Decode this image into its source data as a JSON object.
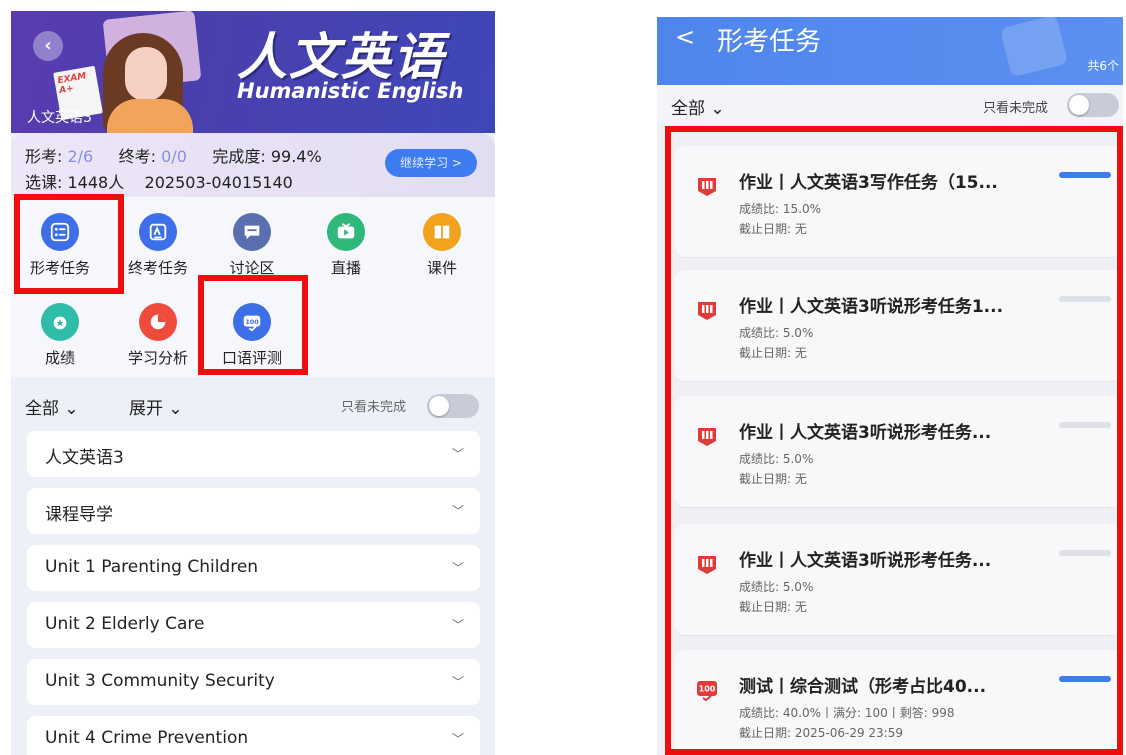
{
  "left": {
    "back_icon": "chevron-left-icon",
    "banner": {
      "title": "人文英语",
      "subtitle": "Humanistic English",
      "course_name": "人文英语3",
      "paper_text": "EXAM A+"
    },
    "stats": {
      "formative_label": "形考: ",
      "formative_value": "2/6",
      "final_label": "终考: ",
      "final_value": "0/0",
      "completion_label": "完成度: ",
      "completion_value": "99.4%",
      "enroll_text": "选课: 1448人",
      "course_code": "202503-04015140",
      "continue_label": "继续学习 >"
    },
    "tiles": [
      {
        "label": "形考任务",
        "icon": "task-list-icon",
        "color": "#3d6fe8"
      },
      {
        "label": "终考任务",
        "icon": "exam-icon",
        "color": "#3d6fe8"
      },
      {
        "label": "讨论区",
        "icon": "chat-bubble-icon",
        "color": "#5a6fb0"
      },
      {
        "label": "直播",
        "icon": "live-tv-icon",
        "color": "#2fb87a"
      },
      {
        "label": "课件",
        "icon": "book-icon",
        "color": "#f2a21c"
      },
      {
        "label": "成绩",
        "icon": "medal-icon",
        "color": "#2fbca8"
      },
      {
        "label": "学习分析",
        "icon": "pie-chart-icon",
        "color": "#f04a3a"
      },
      {
        "label": "口语评测",
        "icon": "speaking-score-icon",
        "color": "#3d6fe8"
      }
    ],
    "filter": {
      "all_label": "全部 ⌄",
      "expand_label": "展开 ⌄",
      "only_incomplete_label": "只看未完成"
    },
    "units": [
      "人文英语3",
      "课程导学",
      "Unit 1 Parenting Children",
      "Unit 2 Elderly Care",
      "Unit 3 Community Security",
      "Unit 4 Crime Prevention"
    ]
  },
  "right": {
    "back_icon": "chevron-left-icon",
    "header_back": "<",
    "title": "形考任务",
    "count_text": "共6个",
    "filter_all_label": "全部 ⌄",
    "only_incomplete_label": "只看未完成",
    "tasks": [
      {
        "title": "作业丨人文英语3写作任务（15...",
        "line1": "成绩比: 15.0%",
        "line2": "截止日期:  无",
        "icon": "homework-icon",
        "progress": 1.0
      },
      {
        "title": "作业丨人文英语3听说形考任务1...",
        "line1": "成绩比: 5.0%",
        "line2": "截止日期:  无",
        "icon": "homework-icon",
        "progress": 0.0
      },
      {
        "title": "作业丨人文英语3听说形考任务...",
        "line1": "成绩比: 5.0%",
        "line2": "截止日期:  无",
        "icon": "homework-icon",
        "progress": 0.0
      },
      {
        "title": "作业丨人文英语3听说形考任务...",
        "line1": "成绩比: 5.0%",
        "line2": "截止日期:  无",
        "icon": "homework-icon",
        "progress": 0.0
      },
      {
        "title": "测试丨综合测试（形考占比40...",
        "line1": "成绩比: 40.0%丨满分: 100丨剩答: 998",
        "line2": "截止日期:  2025-06-29 23:59",
        "icon": "test-score-icon",
        "progress": 1.0
      }
    ]
  },
  "colors": {
    "highlight_box": "#f00d0d",
    "accent_blue": "#3d7cf0",
    "homework_red": "#e03a3a"
  }
}
